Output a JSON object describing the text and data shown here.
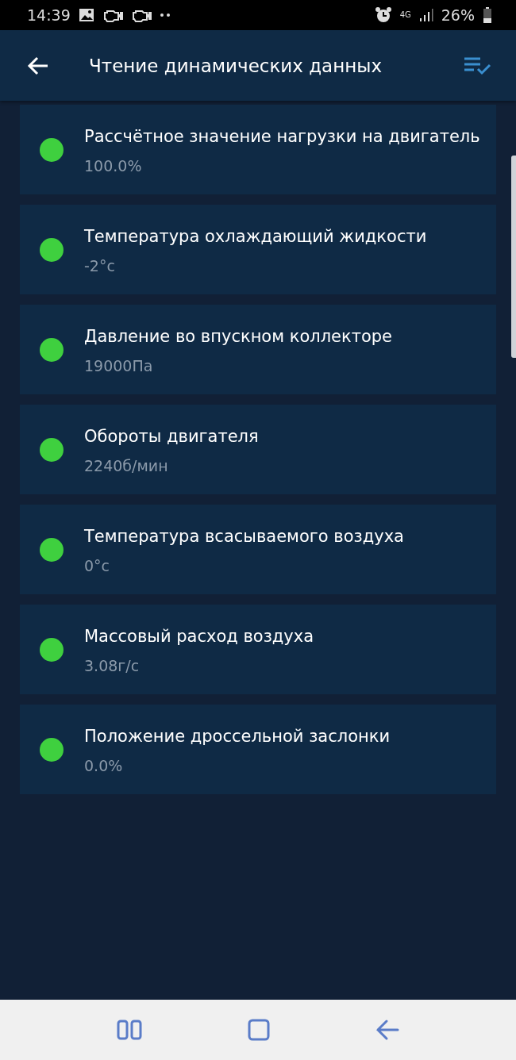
{
  "status_bar": {
    "time": "14:39",
    "network": "4G",
    "battery": "26%"
  },
  "app_bar": {
    "title": "Чтение динамических данных"
  },
  "parameters": [
    {
      "name": "Рассчётное значение нагрузки на двигатель",
      "value": "100.0%",
      "color": "#3fd03f"
    },
    {
      "name": "Температура охлаждающий жидкости",
      "value": "-2°c",
      "color": "#3fd03f"
    },
    {
      "name": "Давление во впускном коллекторе",
      "value": "19000Па",
      "color": "#3fd03f"
    },
    {
      "name": "Обороты двигателя",
      "value": "2240б/мин",
      "color": "#3fd03f"
    },
    {
      "name": "Температура всасываемого воздуха",
      "value": "0°c",
      "color": "#3fd03f"
    },
    {
      "name": "Массовый расход воздуха",
      "value": "3.08г/с",
      "color": "#3fd03f"
    },
    {
      "name": "Положение дроссельной заслонки",
      "value": "0.0%",
      "color": "#3fd03f"
    }
  ]
}
